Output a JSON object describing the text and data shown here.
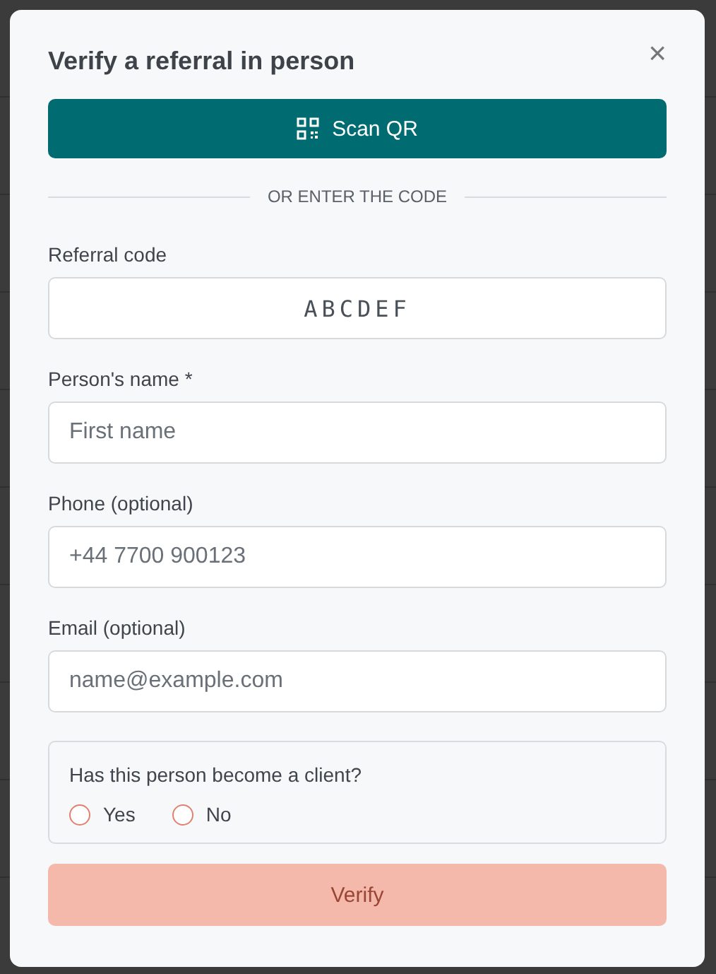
{
  "dialog": {
    "title": "Verify a referral in person",
    "close": "×"
  },
  "scan_button": {
    "label": "Scan QR"
  },
  "divider": "OR ENTER THE CODE",
  "fields": [
    {
      "label": "Referral code",
      "kind": "code",
      "value": "ABCDEF"
    },
    {
      "label": "Person's name *",
      "kind": "text",
      "placeholder": "First name"
    },
    {
      "label": "Phone (optional)",
      "kind": "text",
      "placeholder": "+44 7700 900123"
    },
    {
      "label": "Email (optional)",
      "kind": "text",
      "placeholder": "name@example.com"
    }
  ],
  "client_question": {
    "label": "Has this person become a client?",
    "options": [
      {
        "label": "Yes",
        "selected": false
      },
      {
        "label": "No",
        "selected": false
      }
    ]
  },
  "verify_button": {
    "label": "Verify",
    "disabled": true
  }
}
